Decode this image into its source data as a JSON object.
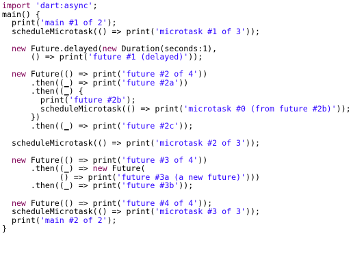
{
  "editor": {
    "language": "dart",
    "colors": {
      "background": "#ffffff",
      "keyword": "#7f0055",
      "string": "#2a00ff",
      "text": "#000000"
    },
    "lines": [
      [
        {
          "t": "import",
          "k": "kw"
        },
        {
          "t": " ",
          "k": "plain"
        },
        {
          "t": "'dart:async'",
          "k": "str"
        },
        {
          "t": ";",
          "k": "plain"
        }
      ],
      [
        {
          "t": "main",
          "k": "fn"
        },
        {
          "t": "() {",
          "k": "plain"
        }
      ],
      [
        {
          "t": "  print(",
          "k": "plain"
        },
        {
          "t": "'main #1 of 2'",
          "k": "str"
        },
        {
          "t": ");",
          "k": "plain"
        }
      ],
      [
        {
          "t": "  scheduleMicrotask(() => print(",
          "k": "plain"
        },
        {
          "t": "'microtask #1 of 3'",
          "k": "str"
        },
        {
          "t": "));",
          "k": "plain"
        }
      ],
      [],
      [
        {
          "t": "  ",
          "k": "plain"
        },
        {
          "t": "new",
          "k": "kw"
        },
        {
          "t": " Future.delayed(",
          "k": "plain"
        },
        {
          "t": "new",
          "k": "kw"
        },
        {
          "t": " Duration(seconds:1),",
          "k": "plain"
        }
      ],
      [
        {
          "t": "      () => print(",
          "k": "plain"
        },
        {
          "t": "'future #1 (delayed)'",
          "k": "str"
        },
        {
          "t": "));",
          "k": "plain"
        }
      ],
      [],
      [
        {
          "t": "  ",
          "k": "plain"
        },
        {
          "t": "new",
          "k": "kw"
        },
        {
          "t": " Future(() => print(",
          "k": "plain"
        },
        {
          "t": "'future #2 of 4'",
          "k": "str"
        },
        {
          "t": "))",
          "k": "plain"
        }
      ],
      [
        {
          "t": "      .then((",
          "k": "plain"
        },
        {
          "t": "_",
          "k": "param"
        },
        {
          "t": ") => print(",
          "k": "plain"
        },
        {
          "t": "'future #2a'",
          "k": "str"
        },
        {
          "t": "))",
          "k": "plain"
        }
      ],
      [
        {
          "t": "      .then((",
          "k": "plain"
        },
        {
          "t": "_",
          "k": "param"
        },
        {
          "t": ") {",
          "k": "plain"
        }
      ],
      [
        {
          "t": "        print(",
          "k": "plain"
        },
        {
          "t": "'future #2b'",
          "k": "str"
        },
        {
          "t": ");",
          "k": "plain"
        }
      ],
      [
        {
          "t": "        scheduleMicrotask(() => print(",
          "k": "plain"
        },
        {
          "t": "'microtask #0 (from future #2b)'",
          "k": "str"
        },
        {
          "t": "));",
          "k": "plain"
        }
      ],
      [
        {
          "t": "      })",
          "k": "plain"
        }
      ],
      [
        {
          "t": "      .then((",
          "k": "plain"
        },
        {
          "t": "_",
          "k": "param"
        },
        {
          "t": ") => print(",
          "k": "plain"
        },
        {
          "t": "'future #2c'",
          "k": "str"
        },
        {
          "t": "));",
          "k": "plain"
        }
      ],
      [],
      [
        {
          "t": "  scheduleMicrotask(() => print(",
          "k": "plain"
        },
        {
          "t": "'microtask #2 of 3'",
          "k": "str"
        },
        {
          "t": "));",
          "k": "plain"
        }
      ],
      [],
      [
        {
          "t": "  ",
          "k": "plain"
        },
        {
          "t": "new",
          "k": "kw"
        },
        {
          "t": " Future(() => print(",
          "k": "plain"
        },
        {
          "t": "'future #3 of 4'",
          "k": "str"
        },
        {
          "t": "))",
          "k": "plain"
        }
      ],
      [
        {
          "t": "      .then((",
          "k": "plain"
        },
        {
          "t": "_",
          "k": "param"
        },
        {
          "t": ") => ",
          "k": "plain"
        },
        {
          "t": "new",
          "k": "kw"
        },
        {
          "t": " Future(",
          "k": "plain"
        }
      ],
      [
        {
          "t": "            () => print(",
          "k": "plain"
        },
        {
          "t": "'future #3a (a new future)'",
          "k": "str"
        },
        {
          "t": ")))",
          "k": "plain"
        }
      ],
      [
        {
          "t": "      .then((",
          "k": "plain"
        },
        {
          "t": "_",
          "k": "param"
        },
        {
          "t": ") => print(",
          "k": "plain"
        },
        {
          "t": "'future #3b'",
          "k": "str"
        },
        {
          "t": "));",
          "k": "plain"
        }
      ],
      [],
      [
        {
          "t": "  ",
          "k": "plain"
        },
        {
          "t": "new",
          "k": "kw"
        },
        {
          "t": " Future(() => print(",
          "k": "plain"
        },
        {
          "t": "'future #4 of 4'",
          "k": "str"
        },
        {
          "t": "));",
          "k": "plain"
        }
      ],
      [
        {
          "t": "  scheduleMicrotask(() => print(",
          "k": "plain"
        },
        {
          "t": "'microtask #3 of 3'",
          "k": "str"
        },
        {
          "t": "));",
          "k": "plain"
        }
      ],
      [
        {
          "t": "  print(",
          "k": "plain"
        },
        {
          "t": "'main #2 of 2'",
          "k": "str"
        },
        {
          "t": ");",
          "k": "plain"
        }
      ],
      [
        {
          "t": "}",
          "k": "plain"
        }
      ]
    ]
  }
}
